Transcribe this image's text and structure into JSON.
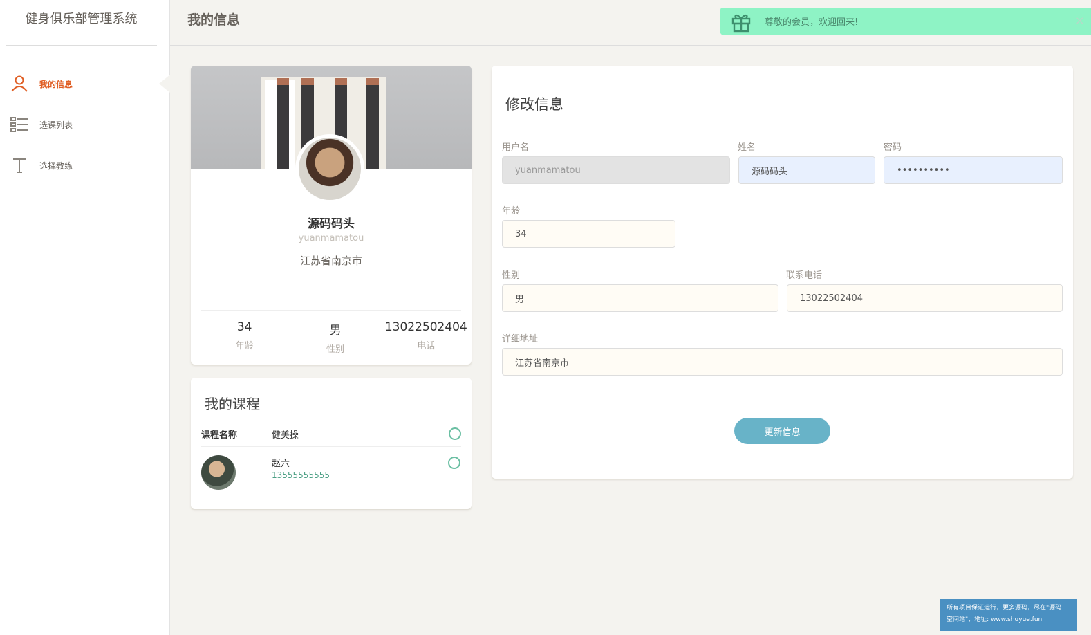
{
  "app": {
    "title": "健身俱乐部管理系统"
  },
  "sidebar": {
    "items": [
      {
        "label": "我的信息",
        "icon": "user-icon",
        "active": true
      },
      {
        "label": "选课列表",
        "icon": "list-icon",
        "active": false
      },
      {
        "label": "选择教练",
        "icon": "text-icon",
        "active": false
      }
    ]
  },
  "header": {
    "title": "我的信息"
  },
  "notice": {
    "text": "尊敬的会员，欢迎回来!",
    "close": "×",
    "color": "#8ef3c5"
  },
  "profile": {
    "name": "源码码头",
    "username": "yuanmamatou",
    "address": "江苏省南京市",
    "stats": [
      {
        "value": "34",
        "label": "年龄"
      },
      {
        "value": "男",
        "label": "性别"
      },
      {
        "value": "13022502404",
        "label": "电话"
      }
    ]
  },
  "courses": {
    "title": "我的课程",
    "course_key": "课程名称",
    "course_name": "健美操",
    "coach_name": "赵六",
    "coach_phone": "13555555555"
  },
  "form": {
    "title": "修改信息",
    "username_label": "用户名",
    "username_value": "yuanmamatou",
    "name_label": "姓名",
    "name_value": "源码码头",
    "password_label": "密码",
    "password_value": "••••••••••",
    "age_label": "年龄",
    "age_value": "34",
    "gender_label": "性别",
    "gender_value": "男",
    "phone_label": "联系电话",
    "phone_value": "13022502404",
    "address_label": "详细地址",
    "address_value": "江苏省南京市",
    "submit_label": "更新信息"
  },
  "footer": {
    "line1": "所有项目保证运行，更多源码，尽在\"源码",
    "line2": "空间站\"，地址: www.shuyue.fun"
  },
  "colors": {
    "accent": "#e05e24",
    "button": "#68b3c8",
    "success": "#6bbfa3"
  }
}
